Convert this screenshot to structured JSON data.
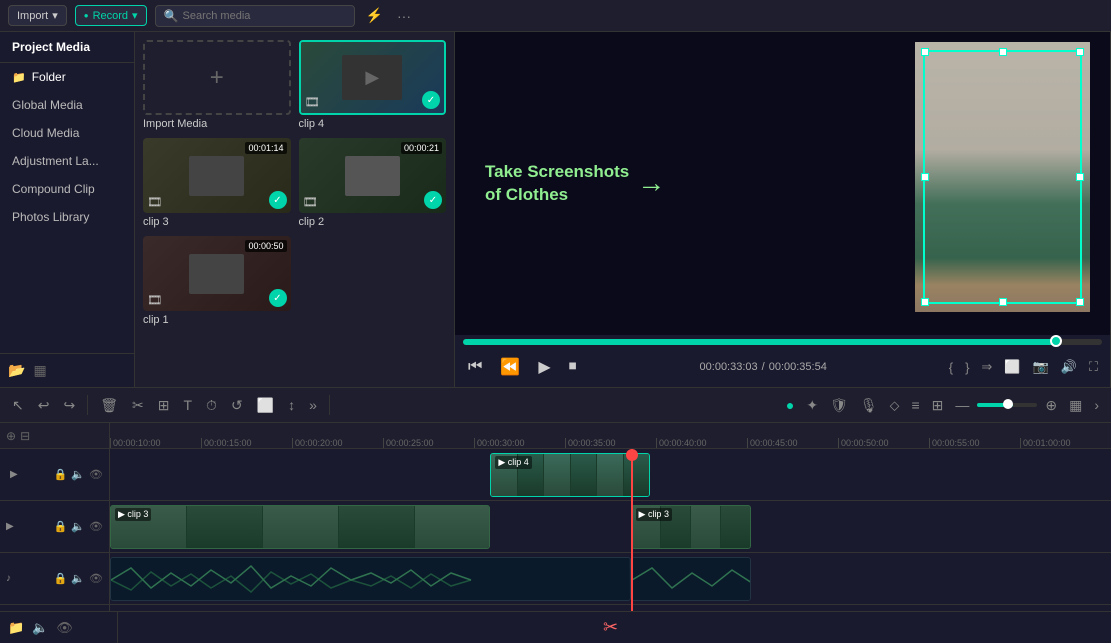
{
  "header": {
    "import_label": "Import",
    "record_label": "Record",
    "search_placeholder": "Search media",
    "filter_icon": "⚡",
    "more_icon": "···"
  },
  "sidebar": {
    "title": "Project Media",
    "items": [
      {
        "label": "Folder",
        "active": true
      },
      {
        "label": "Global Media"
      },
      {
        "label": "Cloud Media"
      },
      {
        "label": "Adjustment La..."
      },
      {
        "label": "Compound Clip"
      },
      {
        "label": "Photos Library"
      }
    ]
  },
  "media_grid": {
    "items": [
      {
        "type": "import",
        "label": "Import Media"
      },
      {
        "type": "clip",
        "label": "clip 4",
        "selected": true
      },
      {
        "type": "clip",
        "label": "clip 3",
        "duration": "00:01:14",
        "checked": true
      },
      {
        "type": "clip",
        "label": "clip 2",
        "duration": "00:00:21",
        "checked": true
      },
      {
        "type": "clip",
        "label": "clip 1",
        "duration": "00:00:50",
        "checked": true
      }
    ]
  },
  "preview": {
    "annotation_line1": "Take Screenshots",
    "annotation_line2": "of Clothes",
    "current_time": "00:00:33:03",
    "total_time": "00:00:35:54",
    "progress_percent": 93
  },
  "edit_toolbar": {
    "tools": [
      "↩",
      "↪",
      "🗑",
      "✂",
      "⊞",
      "T",
      "⏱",
      "↺",
      "⬜",
      "↕",
      "»"
    ],
    "right_tools": [
      "●",
      "✦",
      "🛡",
      "🎙",
      "⇒",
      "≡",
      "⊞",
      "—",
      "⊕",
      "▦"
    ]
  },
  "timeline": {
    "ruler_marks": [
      "00:00:10:00",
      "00:00:15:00",
      "00:00:20:00",
      "00:00:25:00",
      "00:00:30:00",
      "00:00:35:00",
      "00:00:40:00",
      "00:00:45:00",
      "00:00:50:00",
      "00:00:55:00",
      "00:01:00:00"
    ],
    "tracks": [
      {
        "label": "clip 4",
        "type": "video"
      },
      {
        "label": "clip 3",
        "type": "video"
      },
      {
        "label": "",
        "type": "audio"
      }
    ],
    "playhead_position_percent": 52
  },
  "colors": {
    "accent": "#00d4aa",
    "playhead": "#ff4444",
    "clip_border": "#00d4aa",
    "clip_bg_dark": "#1a3a2a",
    "clip_bg_light": "#2a5a4a"
  }
}
